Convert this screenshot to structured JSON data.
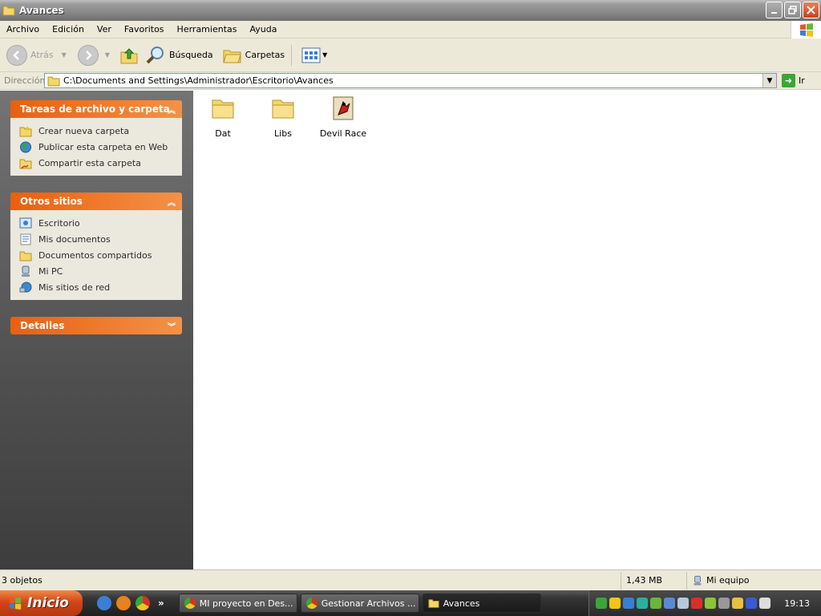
{
  "window": {
    "title": "Avances"
  },
  "menu": [
    "Archivo",
    "Edición",
    "Ver",
    "Favoritos",
    "Herramientas",
    "Ayuda"
  ],
  "toolbar": {
    "back": "Atrás",
    "search": "Búsqueda",
    "folders": "Carpetas"
  },
  "address": {
    "label": "Dirección",
    "path": "C:\\Documents and Settings\\Administrador\\Escritorio\\Avances",
    "go": "Ir"
  },
  "tasks_panel": {
    "title": "Tareas de archivo y carpeta",
    "items": [
      "Crear nueva carpeta",
      "Publicar esta carpeta en Web",
      "Compartir esta carpeta"
    ]
  },
  "places_panel": {
    "title": "Otros sitios",
    "items": [
      "Escritorio",
      "Mis documentos",
      "Documentos compartidos",
      "Mi PC",
      "Mis sitios de red"
    ]
  },
  "details_panel": {
    "title": "Detalles"
  },
  "files": [
    {
      "name": "Dat",
      "icon": "folder-icon"
    },
    {
      "name": "Libs",
      "icon": "folder-icon"
    },
    {
      "name": "Devil Race",
      "icon": "application-icon"
    }
  ],
  "status": {
    "count": "3 objetos",
    "size": "1,43 MB",
    "location": "Mi equipo"
  },
  "taskbar": {
    "start": "Inicio",
    "tasks": [
      "MI proyecto en Des...",
      "Gestionar Archivos ...",
      "Avances"
    ],
    "clock": "19:13"
  },
  "colors": {
    "panel_header": "#e86010",
    "panel_body": "#ebe8de",
    "go": "#3aa636",
    "start": "#d2461a"
  }
}
